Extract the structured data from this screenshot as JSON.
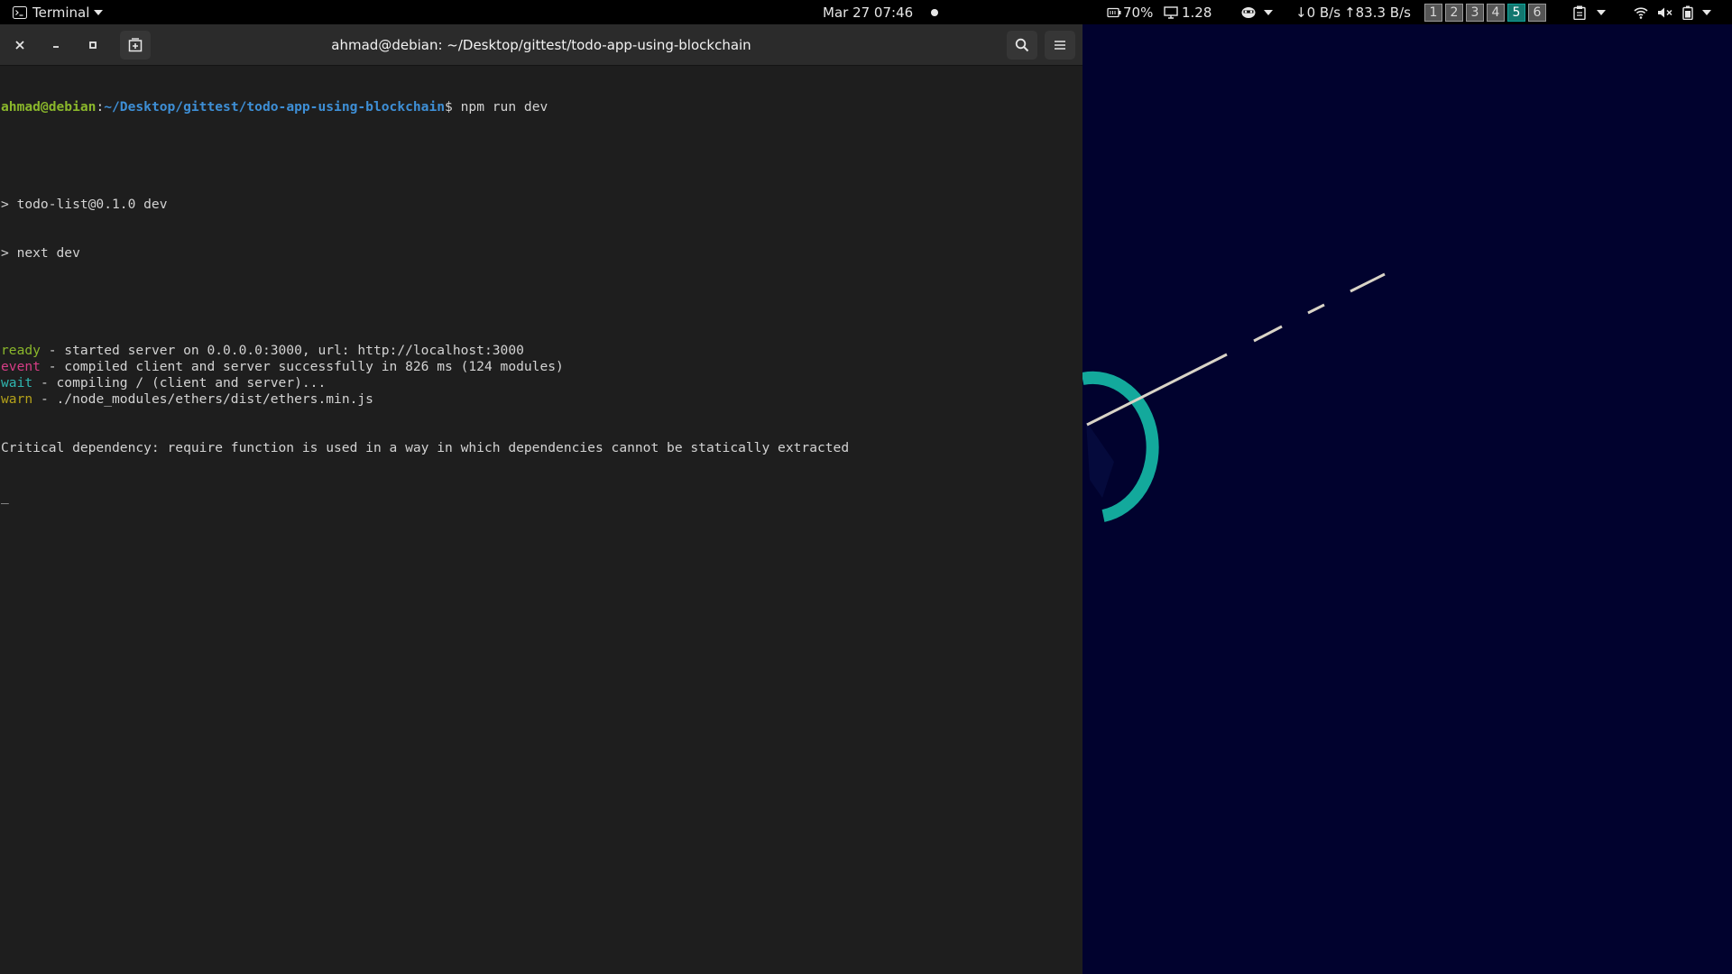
{
  "topbar": {
    "app_menu_label": "Terminal",
    "datetime": "Mar 27  07:46",
    "battery_percent": "70%",
    "load": "1.28",
    "net_down": "0 B/s",
    "net_up": "83.3 B/s",
    "workspaces": [
      "1",
      "2",
      "3",
      "4",
      "5",
      "6"
    ],
    "active_workspace": "5"
  },
  "window": {
    "title": "ahmad@debian: ~/Desktop/gittest/todo-app-using-blockchain"
  },
  "terminal": {
    "prompt_user": "ahmad@debian",
    "prompt_sep": ":",
    "prompt_path": "~/Desktop/gittest/todo-app-using-blockchain",
    "prompt_command": "$ npm run dev",
    "script_line1": "> todo-list@0.1.0 dev",
    "script_line2": "> next dev",
    "logs": [
      {
        "tag": "ready",
        "pad": " ",
        "msg": " - started server on 0.0.0.0:3000, url: http://localhost:3000"
      },
      {
        "tag": "event",
        "pad": " ",
        "msg": " - compiled client and server successfully in 826 ms (124 modules)"
      },
      {
        "tag": "wait",
        "pad": "  ",
        "msg": " - compiling / (client and server)..."
      },
      {
        "tag": "warn",
        "pad": "  ",
        "msg": " - ./node_modules/ethers/dist/ethers.min.js"
      }
    ],
    "error_line": "Critical dependency: require function is used in a way in which dependencies cannot be statically extracted",
    "cursor": "_"
  },
  "colors": {
    "topbar_bg": "#000000",
    "terminal_bg": "#1e1e1e",
    "titlebar_bg": "#2b2b2b",
    "wallpaper_bg": "#01022e",
    "prompt_user": "#8ab72b",
    "prompt_path": "#3e8fd6",
    "ready": "#8ab72b",
    "event": "#d63d86",
    "wait": "#2fb6b0",
    "warn": "#b5a21a",
    "active_workspace": "#12776f",
    "wallpaper_arc": "#13a99c"
  },
  "icons": {
    "app_menu": "terminal-icon",
    "close": "close-icon",
    "minimize": "minimize-icon",
    "maximize": "maximize-icon",
    "new_tab": "new-tab-icon",
    "search": "search-icon",
    "menu": "hamburger-menu-icon",
    "battery_status": "battery-icon",
    "load": "monitor-icon",
    "mask": "mask-icon",
    "clipboard": "clipboard-icon",
    "wifi": "wifi-icon",
    "volume": "volume-muted-icon",
    "power": "battery-power-icon"
  }
}
